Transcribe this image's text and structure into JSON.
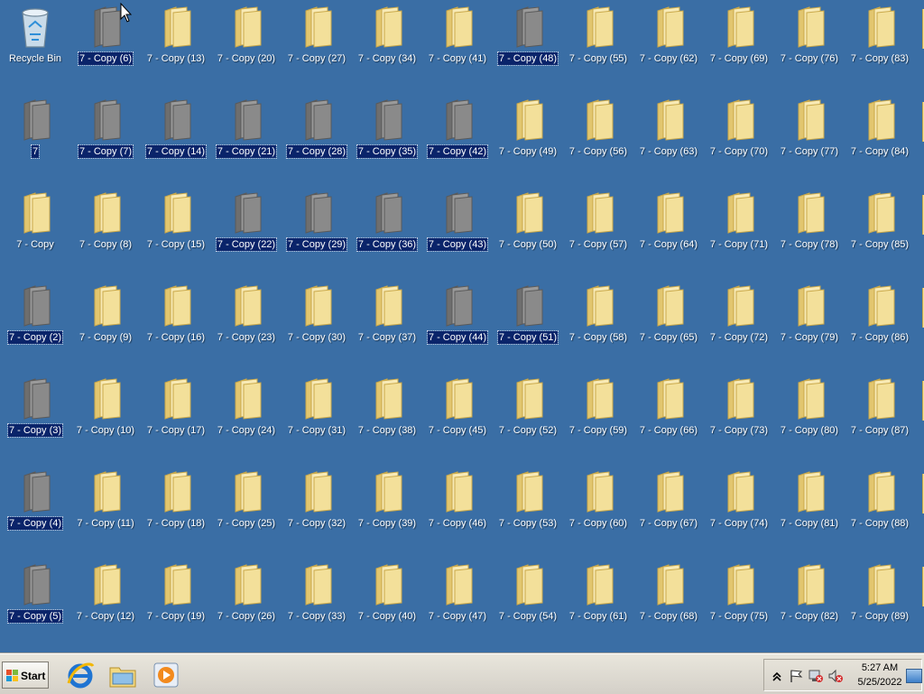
{
  "desktop": {
    "recycle_bin_label": "Recycle Bin",
    "columns": [
      [
        {
          "label": "7 - Copy (6)",
          "selected": true
        },
        {
          "label": "7 - Copy (7)",
          "selected": true
        },
        {
          "label": "7 - Copy (8)",
          "selected": false
        },
        {
          "label": "7 - Copy (9)",
          "selected": false
        },
        {
          "label": "7 - Copy (10)",
          "selected": false
        },
        {
          "label": "7 - Copy (11)",
          "selected": false
        },
        {
          "label": "7 - Copy (12)",
          "selected": false
        }
      ],
      [
        {
          "label": "7 - Copy (13)",
          "selected": false
        },
        {
          "label": "7 - Copy (14)",
          "selected": true
        },
        {
          "label": "7 - Copy (15)",
          "selected": false
        },
        {
          "label": "7 - Copy (16)",
          "selected": false
        },
        {
          "label": "7 - Copy (17)",
          "selected": false
        },
        {
          "label": "7 - Copy (18)",
          "selected": false
        },
        {
          "label": "7 - Copy (19)",
          "selected": false
        }
      ],
      [
        {
          "label": "7 - Copy (20)",
          "selected": false
        },
        {
          "label": "7 - Copy (21)",
          "selected": true
        },
        {
          "label": "7 - Copy (22)",
          "selected": true
        },
        {
          "label": "7 - Copy (23)",
          "selected": false
        },
        {
          "label": "7 - Copy (24)",
          "selected": false
        },
        {
          "label": "7 - Copy (25)",
          "selected": false
        },
        {
          "label": "7 - Copy (26)",
          "selected": false
        }
      ],
      [
        {
          "label": "7 - Copy (27)",
          "selected": false
        },
        {
          "label": "7 - Copy (28)",
          "selected": true
        },
        {
          "label": "7 - Copy (29)",
          "selected": true
        },
        {
          "label": "7 - Copy (30)",
          "selected": false
        },
        {
          "label": "7 - Copy (31)",
          "selected": false
        },
        {
          "label": "7 - Copy (32)",
          "selected": false
        },
        {
          "label": "7 - Copy (33)",
          "selected": false
        }
      ],
      [
        {
          "label": "7 - Copy (34)",
          "selected": false
        },
        {
          "label": "7 - Copy (35)",
          "selected": true
        },
        {
          "label": "7 - Copy (36)",
          "selected": true
        },
        {
          "label": "7 - Copy (37)",
          "selected": false
        },
        {
          "label": "7 - Copy (38)",
          "selected": false
        },
        {
          "label": "7 - Copy (39)",
          "selected": false
        },
        {
          "label": "7 - Copy (40)",
          "selected": false
        }
      ],
      [
        {
          "label": "7 - Copy (41)",
          "selected": false
        },
        {
          "label": "7 - Copy (42)",
          "selected": true
        },
        {
          "label": "7 - Copy (43)",
          "selected": true
        },
        {
          "label": "7 - Copy (44)",
          "selected": true
        },
        {
          "label": "7 - Copy (45)",
          "selected": false
        },
        {
          "label": "7 - Copy (46)",
          "selected": false
        },
        {
          "label": "7 - Copy (47)",
          "selected": false
        }
      ],
      [
        {
          "label": "7 - Copy (48)",
          "selected": true
        },
        {
          "label": "7 - Copy (49)",
          "selected": false
        },
        {
          "label": "7 - Copy (50)",
          "selected": false
        },
        {
          "label": "7 - Copy (51)",
          "selected": true
        },
        {
          "label": "7 - Copy (52)",
          "selected": false
        },
        {
          "label": "7 - Copy (53)",
          "selected": false
        },
        {
          "label": "7 - Copy (54)",
          "selected": false
        }
      ],
      [
        {
          "label": "7 - Copy (55)",
          "selected": false
        },
        {
          "label": "7 - Copy (56)",
          "selected": false
        },
        {
          "label": "7 - Copy (57)",
          "selected": false
        },
        {
          "label": "7 - Copy (58)",
          "selected": false
        },
        {
          "label": "7 - Copy (59)",
          "selected": false
        },
        {
          "label": "7 - Copy (60)",
          "selected": false
        },
        {
          "label": "7 - Copy (61)",
          "selected": false
        }
      ],
      [
        {
          "label": "7 - Copy (62)",
          "selected": false
        },
        {
          "label": "7 - Copy (63)",
          "selected": false
        },
        {
          "label": "7 - Copy (64)",
          "selected": false
        },
        {
          "label": "7 - Copy (65)",
          "selected": false
        },
        {
          "label": "7 - Copy (66)",
          "selected": false
        },
        {
          "label": "7 - Copy (67)",
          "selected": false
        },
        {
          "label": "7 - Copy (68)",
          "selected": false
        }
      ],
      [
        {
          "label": "7 - Copy (69)",
          "selected": false
        },
        {
          "label": "7 - Copy (70)",
          "selected": false
        },
        {
          "label": "7 - Copy (71)",
          "selected": false
        },
        {
          "label": "7 - Copy (72)",
          "selected": false
        },
        {
          "label": "7 - Copy (73)",
          "selected": false
        },
        {
          "label": "7 - Copy (74)",
          "selected": false
        },
        {
          "label": "7 - Copy (75)",
          "selected": false
        }
      ],
      [
        {
          "label": "7 - Copy (76)",
          "selected": false
        },
        {
          "label": "7 - Copy (77)",
          "selected": false
        },
        {
          "label": "7 - Copy (78)",
          "selected": false
        },
        {
          "label": "7 - Copy (79)",
          "selected": false
        },
        {
          "label": "7 - Copy (80)",
          "selected": false
        },
        {
          "label": "7 - Copy (81)",
          "selected": false
        },
        {
          "label": "7 - Copy (82)",
          "selected": false
        }
      ],
      [
        {
          "label": "7 - Copy (83)",
          "selected": false
        },
        {
          "label": "7 - Copy (84)",
          "selected": false
        },
        {
          "label": "7 - Copy (85)",
          "selected": false
        },
        {
          "label": "7 - Copy (86)",
          "selected": false
        },
        {
          "label": "7 - Copy (87)",
          "selected": false
        },
        {
          "label": "7 - Copy (88)",
          "selected": false
        },
        {
          "label": "7 - Copy (89)",
          "selected": false
        }
      ]
    ],
    "first_column_folders": [
      {
        "label": "7",
        "selected": true
      },
      {
        "label": "7 - Copy",
        "selected": false
      },
      {
        "label": "7 - Copy (2)",
        "selected": true
      },
      {
        "label": "7 - Copy (3)",
        "selected": true
      },
      {
        "label": "7 - Copy (4)",
        "selected": true
      },
      {
        "label": "7 - Copy (5)",
        "selected": true
      }
    ]
  },
  "taskbar": {
    "start_label": "Start",
    "pinned_icons": [
      "internet-explorer-icon",
      "windows-explorer-icon",
      "media-player-icon"
    ],
    "tray_icons": [
      "show-hidden-icons-chevron",
      "action-center-flag-icon",
      "network-disconnected-icon",
      "volume-muted-icon"
    ],
    "clock_time": "5:27 AM",
    "clock_date": "5/25/2022"
  },
  "colors": {
    "desktop_background": "#3a6ea5",
    "selection_highlight": "#0a246a",
    "folder_yellow": "#f3e09a",
    "folder_selected_gray": "#8a8a8a",
    "taskbar": "#d4d0c8"
  }
}
